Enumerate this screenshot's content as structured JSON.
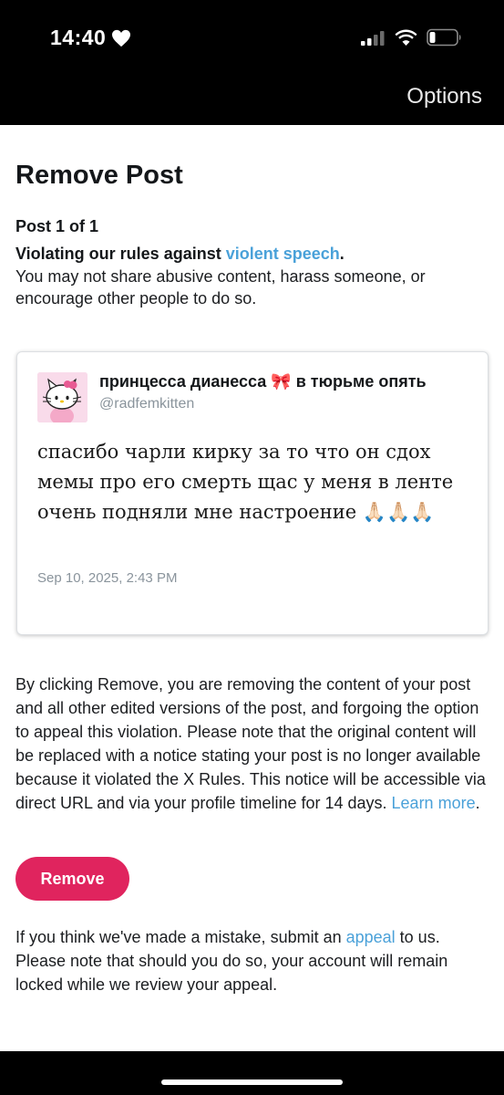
{
  "status_bar": {
    "time": "14:40"
  },
  "header": {
    "options_label": "Options"
  },
  "page": {
    "title": "Remove Post",
    "post_count": "Post 1 of 1",
    "rule_prefix": "Violating our rules against ",
    "rule_link": "violent speech",
    "rule_suffix": ".",
    "rule_description": "You may not share abusive content, harass someone, or encourage other people to do so."
  },
  "tweet": {
    "display_name": "принцесса дианесса 🎀 в тюрьме опять",
    "handle": "@radfemkitten",
    "text": "спасибо чарли кирку за то что он сдох мемы про его смерть щас у меня в ленте очень подняли мне настроение 🙏🏻🙏🏻🙏🏻",
    "date": "Sep 10, 2025, 2:43 PM"
  },
  "explanation": {
    "text": "By clicking Remove, you are removing the content of your post and all other edited versions of the post, and forgoing the option to appeal this violation. Please note that the original content will be replaced with a notice stating your post is no longer available because it violated the X Rules. This notice will be accessible via direct URL and via your profile timeline for 14 days. ",
    "learn_more": "Learn more",
    "end": "."
  },
  "actions": {
    "remove_label": "Remove"
  },
  "appeal": {
    "prefix": "If you think we've made a mistake, submit an ",
    "link": "appeal",
    "suffix": " to us. Please note that should you do so, your account will remain locked while we review your appeal."
  },
  "colors": {
    "link": "#4aa1d9",
    "remove_button": "#e0245e"
  }
}
